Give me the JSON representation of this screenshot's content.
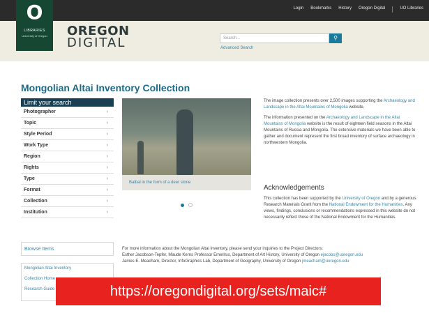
{
  "topbar": {
    "links": [
      "Login",
      "Bookmarks",
      "History",
      "Oregon Digital",
      "UO Libraries"
    ]
  },
  "logo": {
    "letter": "O",
    "line1": "LIBRARIES",
    "line2": "University of Oregon"
  },
  "brand": {
    "line1": "OREGON",
    "line2": "DIGITAL"
  },
  "search": {
    "placeholder": "Search...",
    "advanced": "Advanced Search"
  },
  "page": {
    "title": "Mongolian Altai Inventory Collection"
  },
  "facets": {
    "heading": "Limit your search",
    "items": [
      "Photographer",
      "Topic",
      "Style Period",
      "Work Type",
      "Region",
      "Rights",
      "Type",
      "Format",
      "Collection",
      "Institution"
    ]
  },
  "slideshow": {
    "caption": "Balbal in the form of a deer stone"
  },
  "intro": {
    "p1a": "The image collection presents over 2,500 images supporting the ",
    "p1link": "Archaeology and Landscape in the Altai Mountains of Mongolia",
    "p1b": " website.",
    "p2a": "The information presented on the ",
    "p2link": "Archaeology and Landscape in the Altai Mountains of Mongolia",
    "p2b": " website is the result of eighteen field seasons in the Altai Mountains of Russia and Mongolia. The extensive materials we have been able to gather and document represent the first broad inventory of surface archaeology in northwestern Mongolia."
  },
  "ack": {
    "heading": "Acknowledgements",
    "a": "This collection has been supported by the ",
    "link1": "University of Oregon",
    "b": " and by a generous Research Materials Grant from the ",
    "link2": "National Endowment for the Humanities",
    "c": ". Any views, findings, conclusions or recommendations expressed in this website do not necessarily reflect those of the National Endowment for the Humanities."
  },
  "sidebar": {
    "browse": "Browse Items",
    "links": [
      "Mongolian Altai Inventory",
      "Collection Home",
      "Research Guide"
    ]
  },
  "contact": {
    "line1": "For more information about the Mongolian Altai Inventory, please send your inquiries to the Project Directors:",
    "line2a": "Esther Jacobson-Tepfer, Maude Kerns Professor Emeritus, Department of Art History, University of Oregon ",
    "email1": "ejacobs@uoregon.edu",
    "line3a": "James E. Meacham, Director, InfoGraphics Lab, Department of Geography, University of Oregon ",
    "email2": "jmeacham@uoregon.edu"
  },
  "overlay": {
    "url": "https://oregondigital.org/sets/maic#"
  },
  "colors": {
    "accent": "#1a7a9a",
    "facet_header": "#1a3e52",
    "uo_green": "#154733",
    "overlay_red": "#e8231f"
  }
}
